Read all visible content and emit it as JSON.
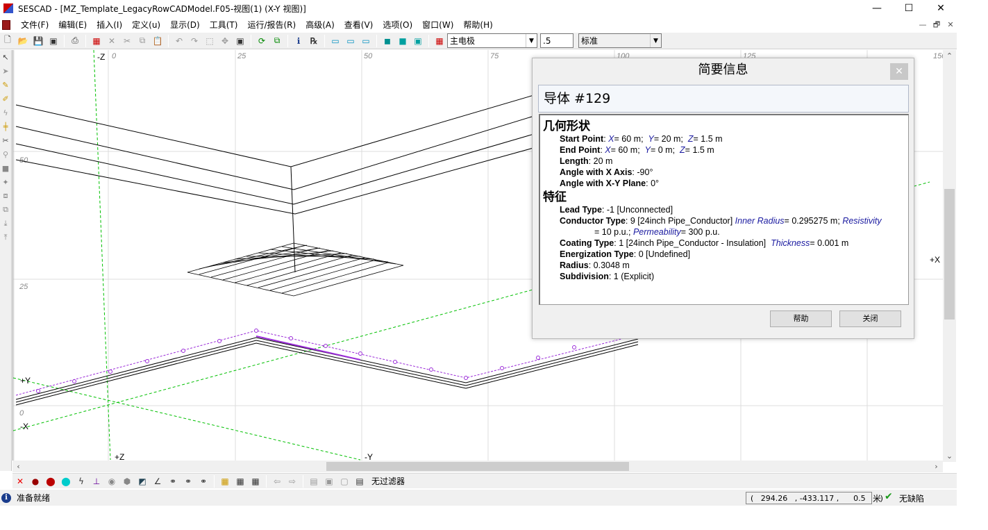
{
  "window": {
    "title": "SESCAD - [MZ_Template_LegacyRowCADModel.F05-视图(1) (X-Y 视图)]",
    "minimize": "—",
    "maximize": "☐",
    "close": "✕"
  },
  "menu": {
    "items": [
      "文件(F)",
      "编辑(E)",
      "插入(I)",
      "定义(u)",
      "显示(D)",
      "工具(T)",
      "运行/报告(R)",
      "高级(A)",
      "查看(V)",
      "选项(O)",
      "窗口(W)",
      "帮助(H)"
    ],
    "mdi_controls": [
      "—",
      "🗗",
      "✕"
    ]
  },
  "toolbar": {
    "layer_combo": "主电极",
    "value_field": ".5",
    "style_combo": "标准"
  },
  "canvas": {
    "ruler_top": [
      "0",
      "25",
      "50",
      "75",
      "100",
      "125",
      "150"
    ],
    "ruler_left": [
      "50",
      "25",
      "0"
    ],
    "axis_labels": {
      "neg_z": "-Z",
      "pos_z": "+Z",
      "pos_y": "+Y",
      "neg_y": "-Y",
      "neg_x": "-X",
      "pos_x": "+X"
    },
    "colors": {
      "axis_green": "#00c000",
      "guide_purple": "#9a2ad8",
      "grid": "#d8d8d8"
    }
  },
  "bottom_toolbar": {
    "filter_label": "无过滤器"
  },
  "status": {
    "ready": "准备就绪",
    "coords": "(   294.26   , -433.117 ,      0.5      )",
    "units": "米",
    "defects": "无缺陷"
  },
  "dialog": {
    "title": "简要信息",
    "close": "✕",
    "header": "导体  #129",
    "geometry_title": "几何形状",
    "start_point": {
      "label": "Start Point",
      "x": "60 m",
      "y": "20 m",
      "z": "1.5 m"
    },
    "end_point": {
      "label": "End Point",
      "x": "60 m",
      "y": "0 m",
      "z": "1.5 m"
    },
    "length": {
      "label": "Length",
      "value": "20 m"
    },
    "angle_x": {
      "label": "Angle with X Axis",
      "value": "-90°"
    },
    "angle_xy": {
      "label": "Angle with X-Y Plane",
      "value": "0°"
    },
    "features_title": "特征",
    "lead_type": {
      "label": "Lead Type",
      "value": "-1 [Unconnected]"
    },
    "conductor_type": {
      "label": "Conductor Type",
      "value": "9 [24inch Pipe_Conductor]",
      "inner_radius_label": "Inner Radius",
      "inner_radius": "= 0.295275 m;",
      "resistivity_label": "Resistivity",
      "resistivity": "= 10 p.u.;",
      "permeability_label": "Permeability",
      "permeability": "= 300 p.u."
    },
    "coating_type": {
      "label": "Coating Type",
      "value": "1 [24inch Pipe_Conductor - Insulation]",
      "thickness_label": "Thickness",
      "thickness": "= 0.001 m"
    },
    "energization": {
      "label": "Energization Type",
      "value": "0 [Undefined]"
    },
    "radius": {
      "label": "Radius",
      "value": "0.3048 m"
    },
    "subdivision": {
      "label": "Subdivision",
      "value": "1 (Explicit)"
    },
    "help_button": "帮助",
    "close_button": "关闭"
  }
}
